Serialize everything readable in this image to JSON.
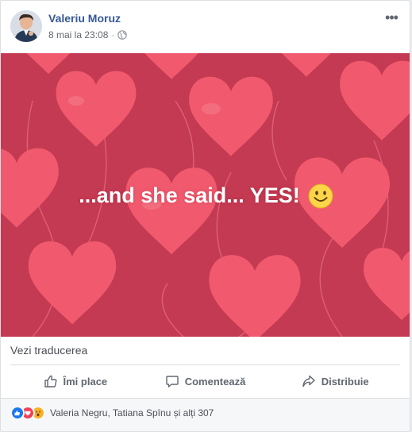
{
  "post": {
    "author": "Valeriu Moruz",
    "timestamp": "8 mai la 23:08",
    "separator": "·",
    "privacy_icon": "globe-icon",
    "more_icon": "more-dots-icon",
    "more_glyph": "•••"
  },
  "image": {
    "caption": "...and she said... YES!",
    "emoji": "smiley-face-emoji",
    "background_color": "#c43a52",
    "heart_color": "#f15a6e"
  },
  "translation": {
    "label": "Vezi traducerea"
  },
  "actions": [
    {
      "label": "Îmi place",
      "icon": "thumbs-up-icon"
    },
    {
      "label": "Comentează",
      "icon": "comment-icon"
    },
    {
      "label": "Distribuie",
      "icon": "share-icon"
    }
  ],
  "reactions": {
    "icons": [
      "like-reaction-icon",
      "love-reaction-icon",
      "wow-reaction-icon"
    ],
    "summary": "Valeria Negru, Tatiana Spînu și alți 307"
  },
  "colors": {
    "link": "#365899",
    "like": "#1877f2",
    "love": "#f33e58",
    "wow": "#f7b125"
  }
}
